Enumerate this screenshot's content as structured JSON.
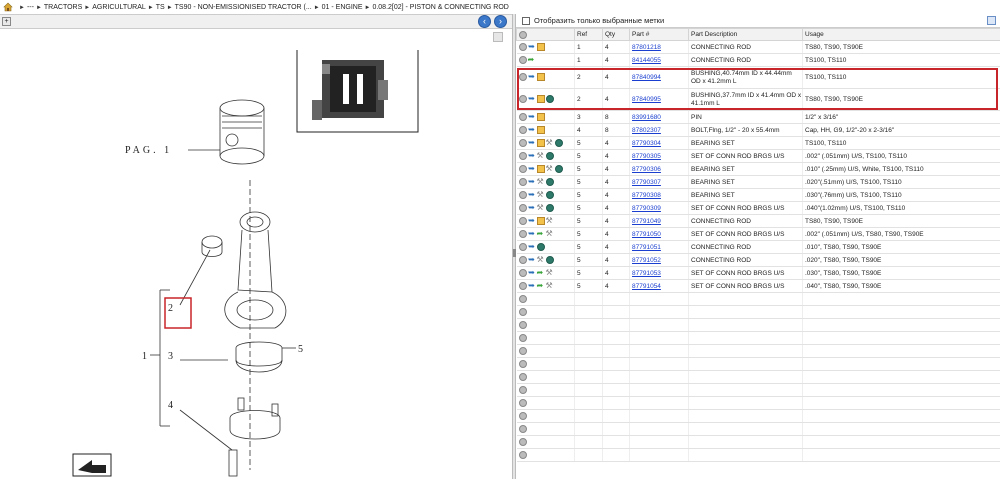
{
  "breadcrumb": [
    "---",
    "TRACTORS",
    "AGRICULTURAL",
    "TS",
    "TS90 - NON-EMISSIONISED TRACTOR (...",
    "01 - ENGINE",
    "0.08.2[02] - PISTON & CONNECTING ROD"
  ],
  "diagram": {
    "page_label": "PAG. 1",
    "callouts": [
      "1",
      "2",
      "3",
      "4",
      "5"
    ]
  },
  "filter": {
    "label": "Отобразить только выбранные метки"
  },
  "table": {
    "headers": [
      "",
      "Ref",
      "Qty",
      "Part #",
      "Part Description",
      "Usage"
    ],
    "rows": [
      {
        "icons": [
          "gear-icon",
          "arrow-icon",
          "package-icon"
        ],
        "ref": "1",
        "qty": "4",
        "part": "87801218",
        "desc": "CONNECTING ROD",
        "usage": "TS80, TS90, TS90E"
      },
      {
        "icons": [
          "gear-icon",
          "green-arrow-icon"
        ],
        "ref": "1",
        "qty": "4",
        "part": "84144055",
        "desc": "CONNECTING ROD",
        "usage": "TS100, TS110"
      },
      {
        "icons": [
          "gear-icon",
          "arrow-icon",
          "package-icon"
        ],
        "ref": "2",
        "qty": "4",
        "part": "87840994",
        "desc": "BUSHING,40.74mm ID x 44.44mm OD x 41.2mm L",
        "usage": "TS100, TS110",
        "tall": true
      },
      {
        "icons": [
          "gear-icon",
          "arrow-icon",
          "package-icon",
          "globe-icon"
        ],
        "ref": "2",
        "qty": "4",
        "part": "87840995",
        "desc": "BUSHING,37.7mm ID x 41.4mm OD x 41.1mm L",
        "usage": "TS80, TS90, TS90E",
        "tall": true
      },
      {
        "icons": [
          "gear-icon",
          "arrow-icon",
          "package-icon"
        ],
        "ref": "3",
        "qty": "8",
        "part": "83991680",
        "desc": "PIN",
        "usage": "1/2\" x 3/16\""
      },
      {
        "icons": [
          "gear-icon",
          "arrow-icon",
          "package-icon"
        ],
        "ref": "4",
        "qty": "8",
        "part": "87802307",
        "desc": "BOLT,Flng, 1/2\" - 20 x 55.4mm",
        "usage": "Cap, HH, G9, 1/2\"-20 x 2-3/16\""
      },
      {
        "icons": [
          "gear-icon",
          "arrow-icon",
          "package-icon",
          "wrench-icon",
          "globe-icon"
        ],
        "ref": "5",
        "qty": "4",
        "part": "87790304",
        "desc": "BEARING SET",
        "usage": "TS100, TS110"
      },
      {
        "icons": [
          "gear-icon",
          "arrow-icon",
          "wrench-icon",
          "globe-icon"
        ],
        "ref": "5",
        "qty": "4",
        "part": "87790305",
        "desc": "SET OF CONN ROD BRGS U/S",
        "usage": ".002\" (.051mm) U/S, TS100, TS110"
      },
      {
        "icons": [
          "gear-icon",
          "arrow-icon",
          "package-icon",
          "wrench-icon",
          "globe-icon"
        ],
        "ref": "5",
        "qty": "4",
        "part": "87790306",
        "desc": "BEARING SET",
        "usage": ".010\" (.25mm) U/S, White, TS100, TS110"
      },
      {
        "icons": [
          "gear-icon",
          "arrow-icon",
          "wrench-icon",
          "globe-icon"
        ],
        "ref": "5",
        "qty": "4",
        "part": "87790307",
        "desc": "BEARING SET",
        "usage": ".020\"(.51mm) U/S, TS100, TS110"
      },
      {
        "icons": [
          "gear-icon",
          "arrow-icon",
          "wrench-icon",
          "globe-icon"
        ],
        "ref": "5",
        "qty": "4",
        "part": "87790308",
        "desc": "BEARING SET",
        "usage": ".030\"(.76mm) U/S, TS100, TS110"
      },
      {
        "icons": [
          "gear-icon",
          "arrow-icon",
          "wrench-icon",
          "globe-icon"
        ],
        "ref": "5",
        "qty": "4",
        "part": "87790309",
        "desc": "SET OF CONN ROD BRGS U/S",
        "usage": ".040\"(1.02mm) U/S, TS100, TS110"
      },
      {
        "icons": [
          "gear-icon",
          "arrow-icon",
          "package-icon",
          "wrench-icon"
        ],
        "ref": "5",
        "qty": "4",
        "part": "87791049",
        "desc": "CONNECTING ROD",
        "usage": "TS80, TS90, TS90E"
      },
      {
        "icons": [
          "gear-icon",
          "arrow-icon",
          "green-arrow-icon",
          "wrench-icon"
        ],
        "ref": "5",
        "qty": "4",
        "part": "87791050",
        "desc": "SET OF CONN ROD BRGS U/S",
        "usage": ".002\" (.051mm) U/S, TS80, TS90, TS90E"
      },
      {
        "icons": [
          "gear-icon",
          "arrow-icon",
          "globe-icon"
        ],
        "ref": "5",
        "qty": "4",
        "part": "87791051",
        "desc": "CONNECTING ROD",
        "usage": ".010\", TS80, TS90, TS90E"
      },
      {
        "icons": [
          "gear-icon",
          "arrow-icon",
          "wrench-icon",
          "globe-icon"
        ],
        "ref": "5",
        "qty": "4",
        "part": "87791052",
        "desc": "CONNECTING ROD",
        "usage": ".020\", TS80, TS90, TS90E"
      },
      {
        "icons": [
          "gear-icon",
          "arrow-icon",
          "green-arrow-icon",
          "wrench-icon"
        ],
        "ref": "5",
        "qty": "4",
        "part": "87791053",
        "desc": "SET OF CONN ROD BRGS U/S",
        "usage": ".030\", TS80, TS90, TS90E"
      },
      {
        "icons": [
          "gear-icon",
          "arrow-icon",
          "green-arrow-icon",
          "wrench-icon"
        ],
        "ref": "5",
        "qty": "4",
        "part": "87791054",
        "desc": "SET OF CONN ROD BRGS U/S",
        "usage": ".040\", TS80, TS90, TS90E"
      }
    ]
  },
  "highlight_color": "#c8252a",
  "link_color": "#1a3ecf"
}
